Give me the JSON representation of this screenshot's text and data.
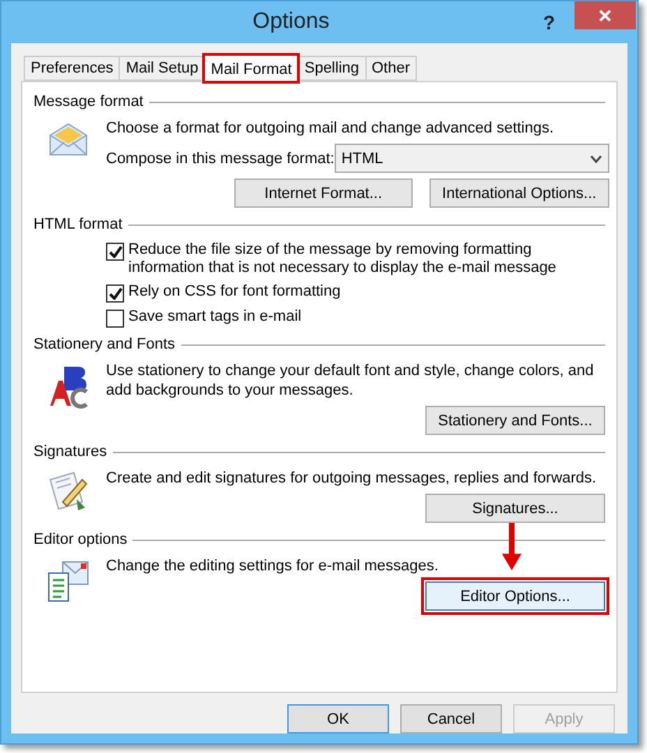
{
  "window": {
    "title": "Options",
    "help": "?",
    "close": "✕"
  },
  "tabs": [
    {
      "label": "Preferences",
      "selected": false,
      "highlighted": false
    },
    {
      "label": "Mail Setup",
      "selected": false,
      "highlighted": false
    },
    {
      "label": "Mail Format",
      "selected": true,
      "highlighted": true
    },
    {
      "label": "Spelling",
      "selected": false,
      "highlighted": false
    },
    {
      "label": "Other",
      "selected": false,
      "highlighted": false
    }
  ],
  "sections": [
    {
      "title": "Message format",
      "description": "Choose a format for outgoing mail and change advanced settings.",
      "compose": {
        "label": "Compose in this message format:",
        "value": "HTML"
      },
      "buttons": [
        {
          "label": "Internet Format...",
          "highlighted": false
        },
        {
          "label": "International Options...",
          "highlighted": false
        }
      ]
    },
    {
      "title": "HTML format",
      "checkboxes": [
        {
          "label": "Reduce the file size of the message by removing formatting information that is not necessary to display the e-mail message",
          "checked": true
        },
        {
          "label": "Rely on CSS for font formatting",
          "checked": true
        },
        {
          "label": "Save smart tags in e-mail",
          "checked": false
        }
      ]
    },
    {
      "title": "Stationery and Fonts",
      "description": "Use stationery to change your default font and style, change colors, and add backgrounds to your messages.",
      "buttons": [
        {
          "label": "Stationery and Fonts...",
          "highlighted": false
        }
      ]
    },
    {
      "title": "Signatures",
      "description": "Create and edit signatures for outgoing messages, replies and forwards.",
      "buttons": [
        {
          "label": "Signatures...",
          "highlighted": false
        }
      ]
    },
    {
      "title": "Editor options",
      "description": "Change the editing settings for e-mail messages.",
      "buttons": [
        {
          "label": "Editor Options...",
          "highlighted": true
        }
      ],
      "arrow": true
    }
  ],
  "footer": [
    {
      "label": "OK",
      "kind": "default",
      "disabled": false
    },
    {
      "label": "Cancel",
      "kind": "normal",
      "disabled": false
    },
    {
      "label": "Apply",
      "kind": "normal",
      "disabled": true
    }
  ]
}
